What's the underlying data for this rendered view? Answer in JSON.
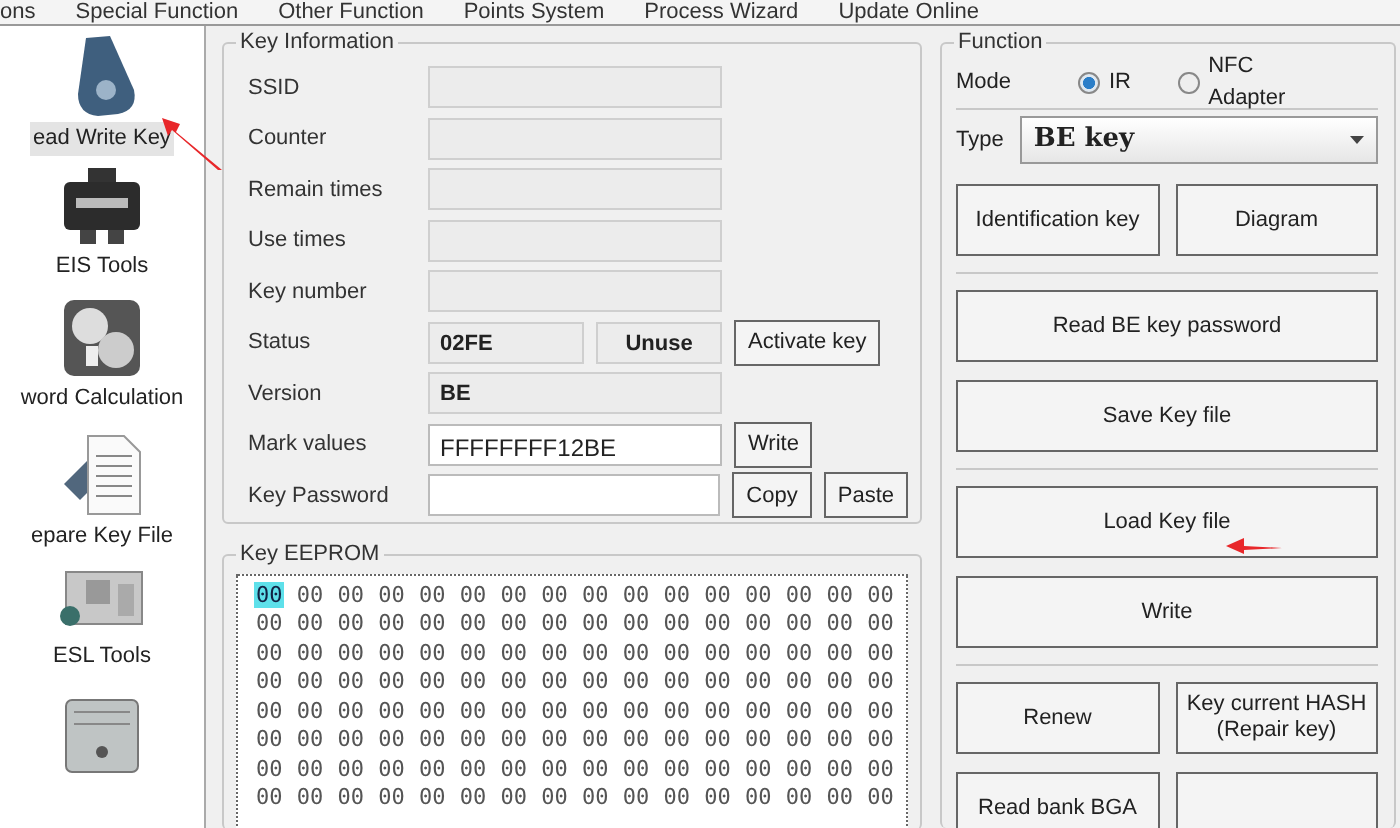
{
  "menu": [
    {
      "label": "ons"
    },
    {
      "label": "Special Function"
    },
    {
      "label": "Other Function"
    },
    {
      "label": "Points System"
    },
    {
      "label": "Process Wizard"
    },
    {
      "label": "Update Online"
    }
  ],
  "sidebar": {
    "items": [
      {
        "label": "ead Write Key",
        "selected": true,
        "kind": "fob"
      },
      {
        "label": "EIS Tools",
        "selected": false,
        "kind": "module"
      },
      {
        "label": "word Calculation",
        "selected": false,
        "kind": "dials"
      },
      {
        "label": "epare Key File",
        "selected": false,
        "kind": "document"
      },
      {
        "label": "ESL Tools",
        "selected": false,
        "kind": "board"
      },
      {
        "selected": false,
        "kind": "ecu"
      }
    ]
  },
  "key_information": {
    "title": "Key Information",
    "rows": [
      {
        "label": "SSID",
        "controls": [
          {
            "kind": "readonly"
          }
        ]
      },
      {
        "label": "Counter",
        "controls": [
          {
            "kind": "readonly"
          }
        ]
      },
      {
        "label": "Remain times",
        "controls": [
          {
            "kind": "readonly"
          }
        ]
      },
      {
        "label": "Use times",
        "controls": [
          {
            "kind": "readonly"
          }
        ]
      },
      {
        "label": "Key number",
        "controls": [
          {
            "kind": "readonly"
          }
        ]
      },
      {
        "label": "Status",
        "controls": [
          {
            "kind": "code",
            "value": "02FE"
          },
          {
            "kind": "state",
            "value": "Unuse"
          },
          {
            "kind": "button",
            "label": "Activate key"
          }
        ]
      },
      {
        "label": "Version",
        "controls": [
          {
            "kind": "readonly",
            "value": "BE"
          }
        ]
      },
      {
        "label": "Mark values",
        "controls": [
          {
            "kind": "input",
            "value": "FFFFFFFF12BE"
          },
          {
            "kind": "button",
            "label": "Write"
          }
        ]
      },
      {
        "label": "Key Password",
        "controls": [
          {
            "kind": "input"
          },
          {
            "kind": "button",
            "label": "Copy"
          },
          {
            "kind": "button",
            "label": "Paste"
          }
        ]
      }
    ]
  },
  "key_eeprom": {
    "title": "Key EEPROM",
    "rows": [
      [
        {
          "text": "00",
          "selected": true
        },
        {
          "text": "00",
          "selected": false
        },
        {
          "text": "00",
          "selected": false
        },
        {
          "text": "00",
          "selected": false
        },
        {
          "text": "00",
          "selected": false
        },
        {
          "text": "00",
          "selected": false
        },
        {
          "text": "00",
          "selected": false
        },
        {
          "text": "00",
          "selected": false
        },
        {
          "text": "00",
          "selected": false
        },
        {
          "text": "00",
          "selected": false
        },
        {
          "text": "00",
          "selected": false
        },
        {
          "text": "00",
          "selected": false
        },
        {
          "text": "00",
          "selected": false
        },
        {
          "text": "00",
          "selected": false
        },
        {
          "text": "00",
          "selected": false
        },
        {
          "text": "00",
          "selected": false
        }
      ],
      [
        {
          "text": "00",
          "selected": false
        },
        {
          "text": "00",
          "selected": false
        },
        {
          "text": "00",
          "selected": false
        },
        {
          "text": "00",
          "selected": false
        },
        {
          "text": "00",
          "selected": false
        },
        {
          "text": "00",
          "selected": false
        },
        {
          "text": "00",
          "selected": false
        },
        {
          "text": "00",
          "selected": false
        },
        {
          "text": "00",
          "selected": false
        },
        {
          "text": "00",
          "selected": false
        },
        {
          "text": "00",
          "selected": false
        },
        {
          "text": "00",
          "selected": false
        },
        {
          "text": "00",
          "selected": false
        },
        {
          "text": "00",
          "selected": false
        },
        {
          "text": "00",
          "selected": false
        },
        {
          "text": "00",
          "selected": false
        }
      ],
      [
        {
          "text": "00",
          "selected": false
        },
        {
          "text": "00",
          "selected": false
        },
        {
          "text": "00",
          "selected": false
        },
        {
          "text": "00",
          "selected": false
        },
        {
          "text": "00",
          "selected": false
        },
        {
          "text": "00",
          "selected": false
        },
        {
          "text": "00",
          "selected": false
        },
        {
          "text": "00",
          "selected": false
        },
        {
          "text": "00",
          "selected": false
        },
        {
          "text": "00",
          "selected": false
        },
        {
          "text": "00",
          "selected": false
        },
        {
          "text": "00",
          "selected": false
        },
        {
          "text": "00",
          "selected": false
        },
        {
          "text": "00",
          "selected": false
        },
        {
          "text": "00",
          "selected": false
        },
        {
          "text": "00",
          "selected": false
        }
      ],
      [
        {
          "text": "00",
          "selected": false
        },
        {
          "text": "00",
          "selected": false
        },
        {
          "text": "00",
          "selected": false
        },
        {
          "text": "00",
          "selected": false
        },
        {
          "text": "00",
          "selected": false
        },
        {
          "text": "00",
          "selected": false
        },
        {
          "text": "00",
          "selected": false
        },
        {
          "text": "00",
          "selected": false
        },
        {
          "text": "00",
          "selected": false
        },
        {
          "text": "00",
          "selected": false
        },
        {
          "text": "00",
          "selected": false
        },
        {
          "text": "00",
          "selected": false
        },
        {
          "text": "00",
          "selected": false
        },
        {
          "text": "00",
          "selected": false
        },
        {
          "text": "00",
          "selected": false
        },
        {
          "text": "00",
          "selected": false
        }
      ],
      [
        {
          "text": "00",
          "selected": false
        },
        {
          "text": "00",
          "selected": false
        },
        {
          "text": "00",
          "selected": false
        },
        {
          "text": "00",
          "selected": false
        },
        {
          "text": "00",
          "selected": false
        },
        {
          "text": "00",
          "selected": false
        },
        {
          "text": "00",
          "selected": false
        },
        {
          "text": "00",
          "selected": false
        },
        {
          "text": "00",
          "selected": false
        },
        {
          "text": "00",
          "selected": false
        },
        {
          "text": "00",
          "selected": false
        },
        {
          "text": "00",
          "selected": false
        },
        {
          "text": "00",
          "selected": false
        },
        {
          "text": "00",
          "selected": false
        },
        {
          "text": "00",
          "selected": false
        },
        {
          "text": "00",
          "selected": false
        }
      ],
      [
        {
          "text": "00",
          "selected": false
        },
        {
          "text": "00",
          "selected": false
        },
        {
          "text": "00",
          "selected": false
        },
        {
          "text": "00",
          "selected": false
        },
        {
          "text": "00",
          "selected": false
        },
        {
          "text": "00",
          "selected": false
        },
        {
          "text": "00",
          "selected": false
        },
        {
          "text": "00",
          "selected": false
        },
        {
          "text": "00",
          "selected": false
        },
        {
          "text": "00",
          "selected": false
        },
        {
          "text": "00",
          "selected": false
        },
        {
          "text": "00",
          "selected": false
        },
        {
          "text": "00",
          "selected": false
        },
        {
          "text": "00",
          "selected": false
        },
        {
          "text": "00",
          "selected": false
        },
        {
          "text": "00",
          "selected": false
        }
      ],
      [
        {
          "text": "00",
          "selected": false
        },
        {
          "text": "00",
          "selected": false
        },
        {
          "text": "00",
          "selected": false
        },
        {
          "text": "00",
          "selected": false
        },
        {
          "text": "00",
          "selected": false
        },
        {
          "text": "00",
          "selected": false
        },
        {
          "text": "00",
          "selected": false
        },
        {
          "text": "00",
          "selected": false
        },
        {
          "text": "00",
          "selected": false
        },
        {
          "text": "00",
          "selected": false
        },
        {
          "text": "00",
          "selected": false
        },
        {
          "text": "00",
          "selected": false
        },
        {
          "text": "00",
          "selected": false
        },
        {
          "text": "00",
          "selected": false
        },
        {
          "text": "00",
          "selected": false
        },
        {
          "text": "00",
          "selected": false
        }
      ],
      [
        {
          "text": "00",
          "selected": false
        },
        {
          "text": "00",
          "selected": false
        },
        {
          "text": "00",
          "selected": false
        },
        {
          "text": "00",
          "selected": false
        },
        {
          "text": "00",
          "selected": false
        },
        {
          "text": "00",
          "selected": false
        },
        {
          "text": "00",
          "selected": false
        },
        {
          "text": "00",
          "selected": false
        },
        {
          "text": "00",
          "selected": false
        },
        {
          "text": "00",
          "selected": false
        },
        {
          "text": "00",
          "selected": false
        },
        {
          "text": "00",
          "selected": false
        },
        {
          "text": "00",
          "selected": false
        },
        {
          "text": "00",
          "selected": false
        },
        {
          "text": "00",
          "selected": false
        },
        {
          "text": "00",
          "selected": false
        }
      ]
    ]
  },
  "function": {
    "title": "Function",
    "mode": {
      "label": "Mode",
      "options": [
        {
          "label": "IR",
          "selected": true
        },
        {
          "label": "NFC Adapter",
          "selected": false
        }
      ]
    },
    "type": {
      "label": "Type",
      "value": "BE key"
    },
    "button_groups": [
      [
        [
          {
            "kind": "button",
            "label": "Identification key"
          },
          {
            "kind": "button",
            "label": "Diagram"
          }
        ]
      ],
      [
        [
          {
            "kind": "button",
            "label": "Read BE key password"
          }
        ],
        [
          {
            "kind": "button",
            "label": "Save Key file"
          }
        ]
      ],
      [
        [
          {
            "kind": "button",
            "label": "Load Key file"
          }
        ],
        [
          {
            "kind": "button",
            "label": "Write"
          }
        ]
      ],
      [
        [
          {
            "kind": "button",
            "label": "Renew"
          },
          {
            "kind": "button",
            "label": "Key current HASH\n(Repair key)"
          }
        ],
        [
          {
            "kind": "button",
            "label": "Read bank BGA"
          },
          {
            "kind": "blank"
          }
        ]
      ]
    ]
  }
}
